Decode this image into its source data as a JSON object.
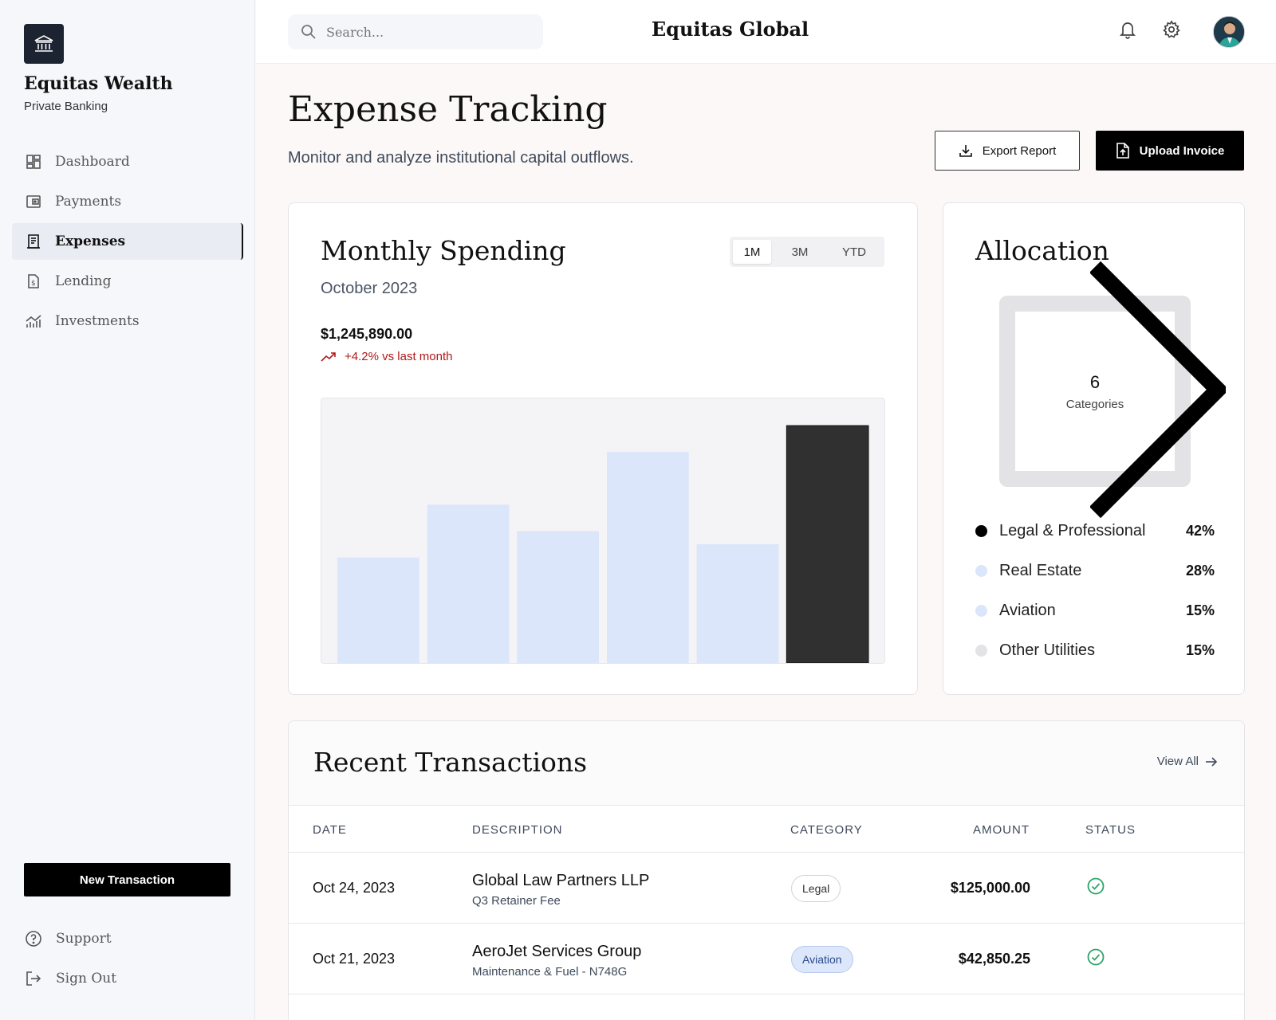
{
  "sidebar": {
    "brand_name": "Equitas Wealth",
    "brand_sub": "Private Banking",
    "nav": [
      {
        "label": "Dashboard",
        "icon": "dashboard-icon"
      },
      {
        "label": "Payments",
        "icon": "wallet-icon"
      },
      {
        "label": "Expenses",
        "icon": "receipt-icon",
        "active": true
      },
      {
        "label": "Lending",
        "icon": "document-dollar-icon"
      },
      {
        "label": "Investments",
        "icon": "chart-icon"
      }
    ],
    "new_transaction": "New Transaction",
    "support": "Support",
    "sign_out": "Sign Out"
  },
  "topbar": {
    "search_placeholder": "Search...",
    "title": "Equitas Global"
  },
  "header": {
    "title": "Expense Tracking",
    "subtitle": "Monitor and analyze institutional capital outflows.",
    "export_label": "Export Report",
    "upload_label": "Upload Invoice"
  },
  "spending": {
    "title": "Monthly Spending",
    "periods": [
      "1M",
      "3M",
      "YTD"
    ],
    "selected_period": "1M",
    "date": "October 2023",
    "total": "$1,245,890.00",
    "change": "+4.2% vs last month"
  },
  "chart_data": {
    "type": "bar",
    "values": [
      40,
      60,
      50,
      80,
      45,
      90
    ],
    "highlight_index": 5,
    "colors": {
      "bar": "#dbe6fb",
      "highlight": "#303030"
    },
    "ylim": [
      0,
      100
    ]
  },
  "allocation": {
    "title": "Allocation",
    "count": "6",
    "count_label": "Categories",
    "items": [
      {
        "name": "Legal & Professional",
        "pct": "42%",
        "color": "#000000"
      },
      {
        "name": "Real Estate",
        "pct": "28%",
        "color": "#dbe6fb"
      },
      {
        "name": "Aviation",
        "pct": "15%",
        "color": "#dbe6fb"
      },
      {
        "name": "Other Utilities",
        "pct": "15%",
        "color": "#e3e3e5"
      }
    ]
  },
  "transactions": {
    "title": "Recent Transactions",
    "view_all": "View All",
    "columns": [
      "DATE",
      "DESCRIPTION",
      "CATEGORY",
      "AMOUNT",
      "STATUS"
    ],
    "rows": [
      {
        "date": "Oct 24, 2023",
        "desc": "Global Law Partners LLP",
        "sub": "Q3 Retainer Fee",
        "category": "Legal",
        "amount": "$125,000.00",
        "status": "completed"
      },
      {
        "date": "Oct 21, 2023",
        "desc": "AeroJet Services Group",
        "sub": "Maintenance & Fuel - N748G",
        "category": "Aviation",
        "amount": "$42,850.25",
        "status": "completed"
      }
    ]
  }
}
